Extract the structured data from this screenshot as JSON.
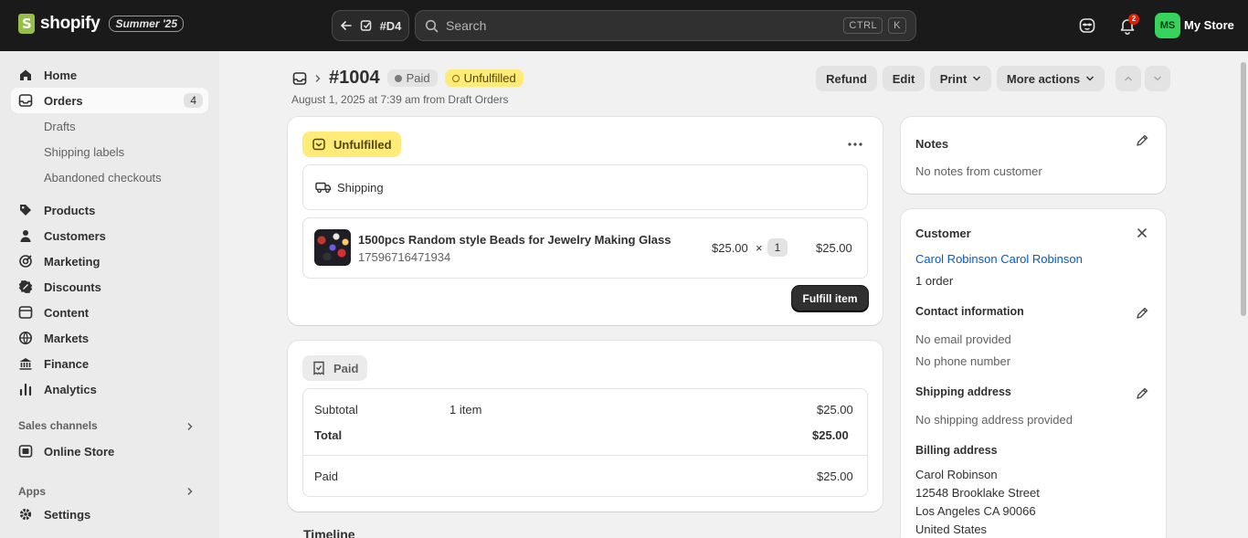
{
  "topbar": {
    "logo_text": "shopify",
    "edition": "Summer '25",
    "back_label": "#D4",
    "search_placeholder": "Search",
    "shortcut_keys": [
      "CTRL",
      "K"
    ],
    "notification_count": "2",
    "avatar_initials": "MS",
    "store_name": "My Store"
  },
  "sidebar": {
    "home": "Home",
    "orders": "Orders",
    "orders_count": "4",
    "order_subitems": [
      "Drafts",
      "Shipping labels",
      "Abandoned checkouts"
    ],
    "items": [
      "Products",
      "Customers",
      "Marketing",
      "Discounts",
      "Content",
      "Markets",
      "Finance",
      "Analytics"
    ],
    "sales_channels_label": "Sales channels",
    "online_store": "Online Store",
    "apps_label": "Apps",
    "settings": "Settings"
  },
  "order": {
    "number": "#1004",
    "payment_badge": "Paid",
    "fulfillment_badge": "Unfulfilled",
    "subtitle": "August 1, 2025 at 7:39 am from Draft Orders",
    "actions": {
      "refund": "Refund",
      "edit": "Edit",
      "print": "Print",
      "more": "More actions"
    }
  },
  "fulfillment_card": {
    "status": "Unfulfilled",
    "delivery_method": "Shipping",
    "item": {
      "title": "1500pcs Random style Beads for Jewelry Making Glass",
      "sku": "17596716471934",
      "unit_price": "$25.00",
      "times": "×",
      "quantity": "1",
      "total": "$25.00"
    },
    "fulfill_button": "Fulfill item"
  },
  "payment_card": {
    "status": "Paid",
    "subtotal_label": "Subtotal",
    "subtotal_items": "1 item",
    "subtotal_value": "$25.00",
    "total_label": "Total",
    "total_value": "$25.00",
    "paid_label": "Paid",
    "paid_value": "$25.00"
  },
  "timeline_label": "Timeline",
  "notes_card": {
    "title": "Notes",
    "body": "No notes from customer"
  },
  "customer_card": {
    "title": "Customer",
    "name": "Carol Robinson Carol Robinson",
    "orders": "1 order",
    "contact_title": "Contact information",
    "email": "No email provided",
    "phone": "No phone number",
    "shipping_title": "Shipping address",
    "shipping_body": "No shipping address provided",
    "billing_title": "Billing address",
    "billing_lines": [
      "Carol Robinson",
      "12548 Brooklake Street",
      "Los Angeles CA 90066",
      "United States"
    ]
  },
  "colors": {
    "topbar_bg": "#1a1a1a",
    "unfulfilled_badge": "#ffeb78",
    "link": "#005bd3",
    "primary_button": "#303030",
    "avatar": "#36d35d"
  }
}
